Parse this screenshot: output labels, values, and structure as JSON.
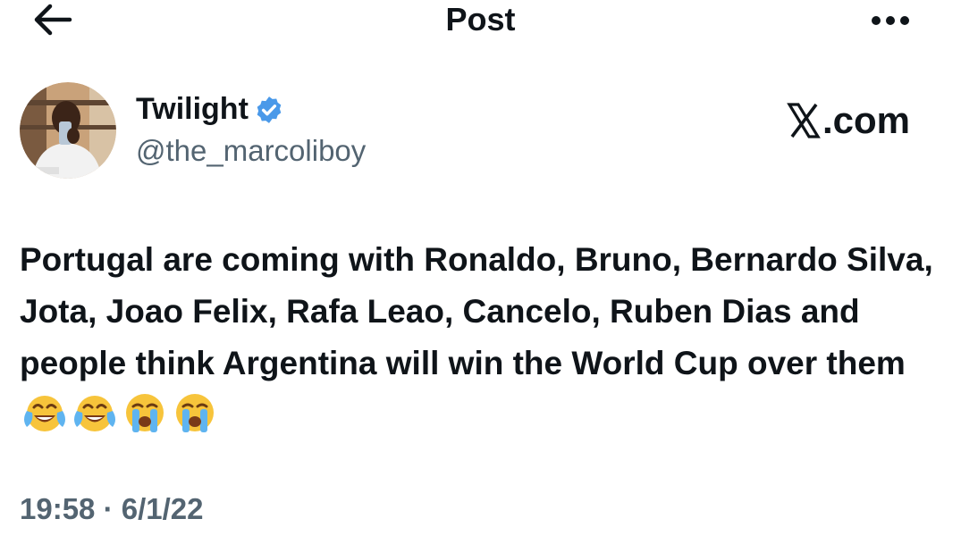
{
  "header": {
    "title": "Post",
    "back_icon": "arrow-left-icon",
    "more_icon": "more-horizontal-icon"
  },
  "author": {
    "name": "Twilight",
    "handle": "@the_marcoliboy",
    "verified": true,
    "verified_color": "#4a99e9"
  },
  "brand": {
    "text": ".com",
    "logo_icon": "x-logo-icon"
  },
  "tweet": {
    "text": "Portugal are coming with Ronaldo, Bruno, Bernardo Silva, Jota, Joao Felix, Rafa Leao, Cancelo, Ruben Dias and people think Argentina will win the World Cup over them",
    "emojis": [
      "face-with-tears-of-joy",
      "face-with-tears-of-joy",
      "loudly-crying-face",
      "loudly-crying-face"
    ]
  },
  "meta": {
    "time": "19:58",
    "separator": "·",
    "date": "6/1/22"
  },
  "colors": {
    "text_primary": "#0f1419",
    "text_secondary": "#536471",
    "background": "#ffffff"
  }
}
